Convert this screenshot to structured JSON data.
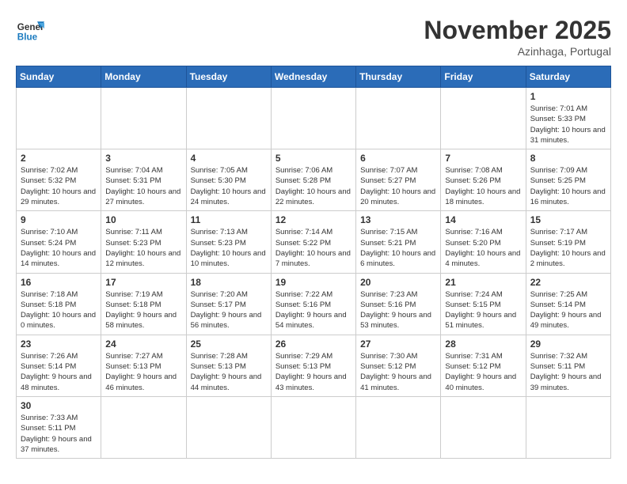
{
  "logo": {
    "general": "General",
    "blue": "Blue"
  },
  "title": "November 2025",
  "location": "Azinhaga, Portugal",
  "weekdays": [
    "Sunday",
    "Monday",
    "Tuesday",
    "Wednesday",
    "Thursday",
    "Friday",
    "Saturday"
  ],
  "weeks": [
    [
      {
        "day": "",
        "info": ""
      },
      {
        "day": "",
        "info": ""
      },
      {
        "day": "",
        "info": ""
      },
      {
        "day": "",
        "info": ""
      },
      {
        "day": "",
        "info": ""
      },
      {
        "day": "",
        "info": ""
      },
      {
        "day": "1",
        "info": "Sunrise: 7:01 AM\nSunset: 5:33 PM\nDaylight: 10 hours\nand 31 minutes."
      }
    ],
    [
      {
        "day": "2",
        "info": "Sunrise: 7:02 AM\nSunset: 5:32 PM\nDaylight: 10 hours\nand 29 minutes."
      },
      {
        "day": "3",
        "info": "Sunrise: 7:04 AM\nSunset: 5:31 PM\nDaylight: 10 hours\nand 27 minutes."
      },
      {
        "day": "4",
        "info": "Sunrise: 7:05 AM\nSunset: 5:30 PM\nDaylight: 10 hours\nand 24 minutes."
      },
      {
        "day": "5",
        "info": "Sunrise: 7:06 AM\nSunset: 5:28 PM\nDaylight: 10 hours\nand 22 minutes."
      },
      {
        "day": "6",
        "info": "Sunrise: 7:07 AM\nSunset: 5:27 PM\nDaylight: 10 hours\nand 20 minutes."
      },
      {
        "day": "7",
        "info": "Sunrise: 7:08 AM\nSunset: 5:26 PM\nDaylight: 10 hours\nand 18 minutes."
      },
      {
        "day": "8",
        "info": "Sunrise: 7:09 AM\nSunset: 5:25 PM\nDaylight: 10 hours\nand 16 minutes."
      }
    ],
    [
      {
        "day": "9",
        "info": "Sunrise: 7:10 AM\nSunset: 5:24 PM\nDaylight: 10 hours\nand 14 minutes."
      },
      {
        "day": "10",
        "info": "Sunrise: 7:11 AM\nSunset: 5:23 PM\nDaylight: 10 hours\nand 12 minutes."
      },
      {
        "day": "11",
        "info": "Sunrise: 7:13 AM\nSunset: 5:23 PM\nDaylight: 10 hours\nand 10 minutes."
      },
      {
        "day": "12",
        "info": "Sunrise: 7:14 AM\nSunset: 5:22 PM\nDaylight: 10 hours\nand 7 minutes."
      },
      {
        "day": "13",
        "info": "Sunrise: 7:15 AM\nSunset: 5:21 PM\nDaylight: 10 hours\nand 6 minutes."
      },
      {
        "day": "14",
        "info": "Sunrise: 7:16 AM\nSunset: 5:20 PM\nDaylight: 10 hours\nand 4 minutes."
      },
      {
        "day": "15",
        "info": "Sunrise: 7:17 AM\nSunset: 5:19 PM\nDaylight: 10 hours\nand 2 minutes."
      }
    ],
    [
      {
        "day": "16",
        "info": "Sunrise: 7:18 AM\nSunset: 5:18 PM\nDaylight: 10 hours\nand 0 minutes."
      },
      {
        "day": "17",
        "info": "Sunrise: 7:19 AM\nSunset: 5:18 PM\nDaylight: 9 hours\nand 58 minutes."
      },
      {
        "day": "18",
        "info": "Sunrise: 7:20 AM\nSunset: 5:17 PM\nDaylight: 9 hours\nand 56 minutes."
      },
      {
        "day": "19",
        "info": "Sunrise: 7:22 AM\nSunset: 5:16 PM\nDaylight: 9 hours\nand 54 minutes."
      },
      {
        "day": "20",
        "info": "Sunrise: 7:23 AM\nSunset: 5:16 PM\nDaylight: 9 hours\nand 53 minutes."
      },
      {
        "day": "21",
        "info": "Sunrise: 7:24 AM\nSunset: 5:15 PM\nDaylight: 9 hours\nand 51 minutes."
      },
      {
        "day": "22",
        "info": "Sunrise: 7:25 AM\nSunset: 5:14 PM\nDaylight: 9 hours\nand 49 minutes."
      }
    ],
    [
      {
        "day": "23",
        "info": "Sunrise: 7:26 AM\nSunset: 5:14 PM\nDaylight: 9 hours\nand 48 minutes."
      },
      {
        "day": "24",
        "info": "Sunrise: 7:27 AM\nSunset: 5:13 PM\nDaylight: 9 hours\nand 46 minutes."
      },
      {
        "day": "25",
        "info": "Sunrise: 7:28 AM\nSunset: 5:13 PM\nDaylight: 9 hours\nand 44 minutes."
      },
      {
        "day": "26",
        "info": "Sunrise: 7:29 AM\nSunset: 5:13 PM\nDaylight: 9 hours\nand 43 minutes."
      },
      {
        "day": "27",
        "info": "Sunrise: 7:30 AM\nSunset: 5:12 PM\nDaylight: 9 hours\nand 41 minutes."
      },
      {
        "day": "28",
        "info": "Sunrise: 7:31 AM\nSunset: 5:12 PM\nDaylight: 9 hours\nand 40 minutes."
      },
      {
        "day": "29",
        "info": "Sunrise: 7:32 AM\nSunset: 5:11 PM\nDaylight: 9 hours\nand 39 minutes."
      }
    ],
    [
      {
        "day": "30",
        "info": "Sunrise: 7:33 AM\nSunset: 5:11 PM\nDaylight: 9 hours\nand 37 minutes."
      },
      {
        "day": "",
        "info": ""
      },
      {
        "day": "",
        "info": ""
      },
      {
        "day": "",
        "info": ""
      },
      {
        "day": "",
        "info": ""
      },
      {
        "day": "",
        "info": ""
      },
      {
        "day": "",
        "info": ""
      }
    ]
  ]
}
